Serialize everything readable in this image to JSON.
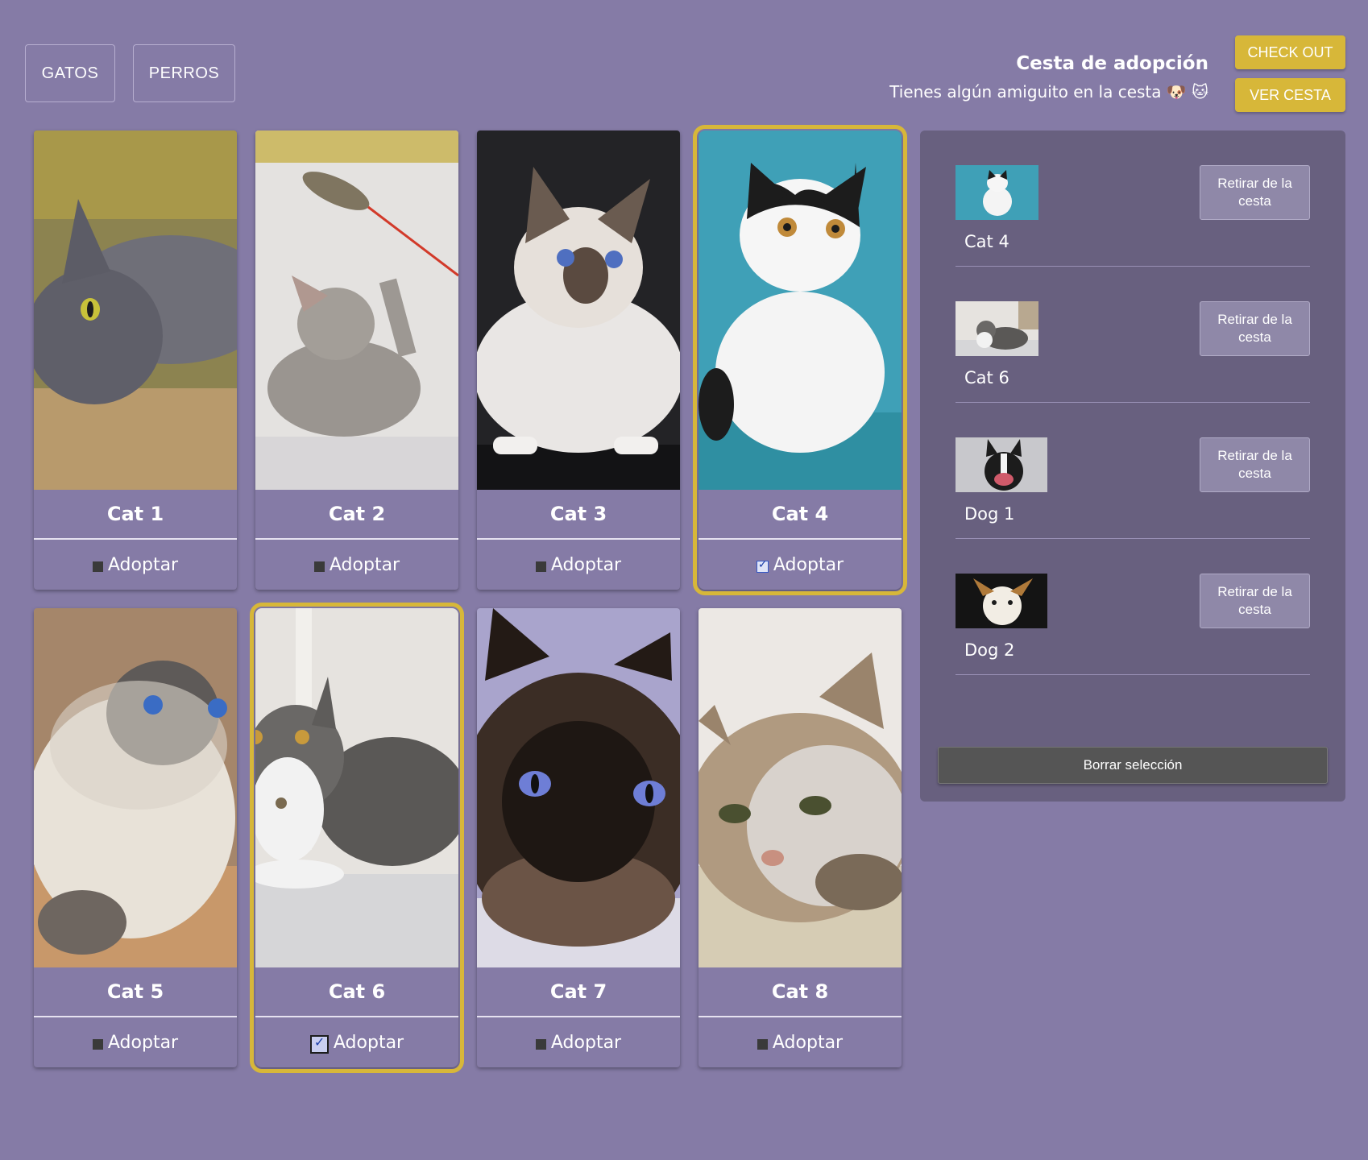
{
  "nav": {
    "cats_label": "GATOS",
    "dogs_label": "PERROS"
  },
  "basket_header": {
    "title": "Cesta de adopción",
    "subtitle": "Tienes algún amiguito en la cesta 🐶 🐱"
  },
  "actions": {
    "checkout_label": "CHECK OUT",
    "view_basket_label": "VER CESTA"
  },
  "cards": [
    {
      "name": "Cat 1",
      "adopt_label": "Adoptar",
      "checked": false
    },
    {
      "name": "Cat 2",
      "adopt_label": "Adoptar",
      "checked": false
    },
    {
      "name": "Cat 3",
      "adopt_label": "Adoptar",
      "checked": false
    },
    {
      "name": "Cat 4",
      "adopt_label": "Adoptar",
      "checked": true
    },
    {
      "name": "Cat 5",
      "adopt_label": "Adoptar",
      "checked": false
    },
    {
      "name": "Cat 6",
      "adopt_label": "Adoptar",
      "checked": true
    },
    {
      "name": "Cat 7",
      "adopt_label": "Adoptar",
      "checked": false
    },
    {
      "name": "Cat 8",
      "adopt_label": "Adoptar",
      "checked": false
    }
  ],
  "basket": {
    "items": [
      {
        "name": "Cat 4",
        "remove_label": "Retirar de la cesta"
      },
      {
        "name": "Cat 6",
        "remove_label": "Retirar de la cesta"
      },
      {
        "name": "Dog 1",
        "remove_label": "Retirar de la cesta"
      },
      {
        "name": "Dog 2",
        "remove_label": "Retirar de la cesta"
      }
    ],
    "clear_label": "Borrar selección"
  },
  "colors": {
    "background": "#857ba6",
    "panel": "#68607f",
    "accent": "#d7b739"
  }
}
